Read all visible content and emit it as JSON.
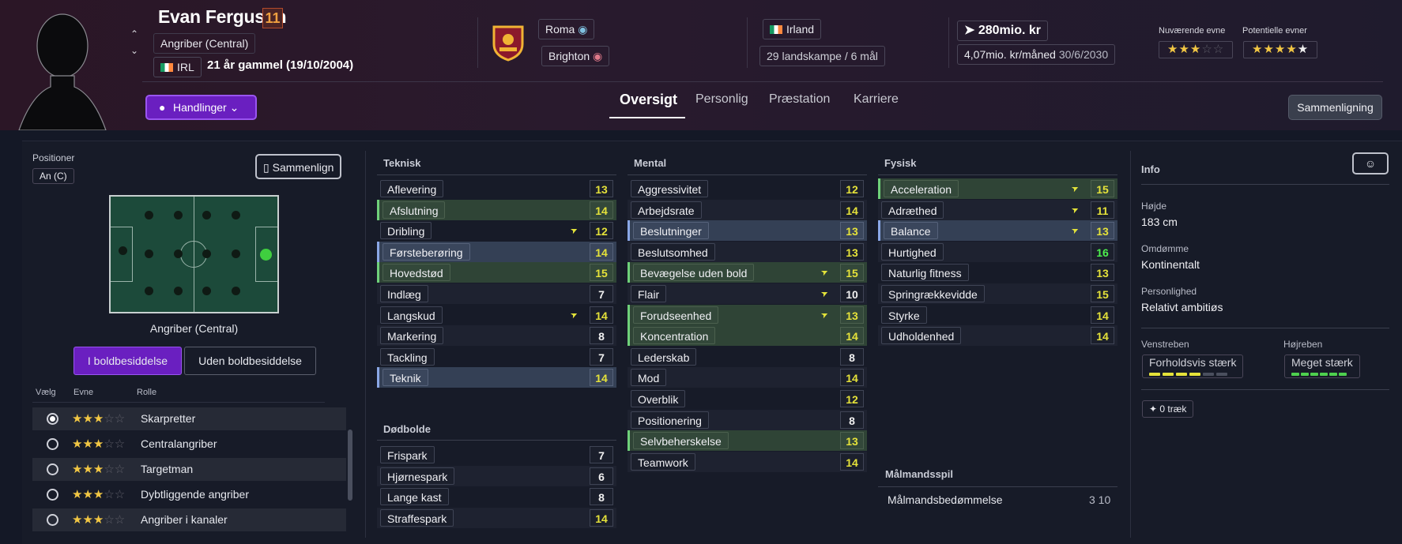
{
  "player": {
    "name": "Evan Ferguson",
    "number": "11",
    "position": "Angriber (Central)",
    "nation_code": "IRL",
    "age": "21 år gammel (19/10/2004)"
  },
  "clubs": {
    "current": "Roma",
    "loan": "Brighton"
  },
  "nation": {
    "name": "Irland",
    "caps": "29 landskampe / 6 mål"
  },
  "contract": {
    "value": "280mio. kr",
    "wage": "4,07mio. kr/måned",
    "expires": "30/6/2030"
  },
  "ability": {
    "current_label": "Nuværende evne",
    "potential_label": "Potentielle evner",
    "current_stars": 3,
    "potential_stars": 4.5
  },
  "nav": {
    "actions": "Handlinger",
    "tabs": [
      "Oversigt",
      "Personlig",
      "Præstation",
      "Karriere"
    ],
    "compare": "Sammenligning"
  },
  "positions_panel": {
    "title": "Positioner",
    "badge": "An (C)",
    "compare_btn": "Sammenlign",
    "pitch_label": "Angriber (Central)",
    "toggle_in": "I boldbesiddelse",
    "toggle_out": "Uden boldbesiddelse",
    "headers": {
      "select": "Vælg",
      "ability": "Evne",
      "role": "Rolle"
    },
    "roles": [
      {
        "name": "Skarpretter",
        "selected": true
      },
      {
        "name": "Centralangriber",
        "selected": false
      },
      {
        "name": "Targetman",
        "selected": false
      },
      {
        "name": "Dybtliggende angriber",
        "selected": false
      },
      {
        "name": "Angriber i kanaler",
        "selected": false
      }
    ]
  },
  "attributes": {
    "technical_title": "Teknisk",
    "technical": [
      {
        "name": "Aflevering",
        "value": "13"
      },
      {
        "name": "Afslutning",
        "value": "14"
      },
      {
        "name": "Dribling",
        "value": "12"
      },
      {
        "name": "Førsteberøring",
        "value": "14"
      },
      {
        "name": "Hovedstød",
        "value": "15"
      },
      {
        "name": "Indlæg",
        "value": "7"
      },
      {
        "name": "Langskud",
        "value": "14"
      },
      {
        "name": "Markering",
        "value": "8"
      },
      {
        "name": "Tackling",
        "value": "7"
      },
      {
        "name": "Teknik",
        "value": "14"
      }
    ],
    "setpieces_title": "Dødbolde",
    "setpieces": [
      {
        "name": "Frispark",
        "value": "7"
      },
      {
        "name": "Hjørnespark",
        "value": "6"
      },
      {
        "name": "Lange kast",
        "value": "8"
      },
      {
        "name": "Straffespark",
        "value": "14"
      }
    ],
    "mental_title": "Mental",
    "mental": [
      {
        "name": "Aggressivitet",
        "value": "12"
      },
      {
        "name": "Arbejdsrate",
        "value": "14"
      },
      {
        "name": "Beslutninger",
        "value": "13"
      },
      {
        "name": "Beslutsomhed",
        "value": "13"
      },
      {
        "name": "Bevægelse uden bold",
        "value": "15"
      },
      {
        "name": "Flair",
        "value": "10"
      },
      {
        "name": "Forudseenhed",
        "value": "13"
      },
      {
        "name": "Koncentration",
        "value": "14"
      },
      {
        "name": "Lederskab",
        "value": "8"
      },
      {
        "name": "Mod",
        "value": "14"
      },
      {
        "name": "Overblik",
        "value": "12"
      },
      {
        "name": "Positionering",
        "value": "8"
      },
      {
        "name": "Selvbeherskelse",
        "value": "13"
      },
      {
        "name": "Teamwork",
        "value": "14"
      }
    ],
    "physical_title": "Fysisk",
    "physical": [
      {
        "name": "Acceleration",
        "value": "15"
      },
      {
        "name": "Adræthed",
        "value": "11"
      },
      {
        "name": "Balance",
        "value": "13"
      },
      {
        "name": "Hurtighed",
        "value": "16"
      },
      {
        "name": "Naturlig fitness",
        "value": "13"
      },
      {
        "name": "Springrækkevidde",
        "value": "15"
      },
      {
        "name": "Styrke",
        "value": "14"
      },
      {
        "name": "Udholdenhed",
        "value": "14"
      }
    ],
    "gk_title": "Målmandsspil",
    "gk_label": "Målmandsbedømmelse",
    "gk_value": "3 10"
  },
  "info": {
    "title": "Info",
    "height_label": "Højde",
    "height": "183 cm",
    "reputation_label": "Omdømme",
    "reputation": "Kontinentalt",
    "personality_label": "Personlighed",
    "personality": "Relativt ambitiøs",
    "left_foot_label": "Venstreben",
    "left_foot": "Forholdsvis stærk",
    "right_foot_label": "Højreben",
    "right_foot": "Meget stærk",
    "traits": "0 træk"
  },
  "colors": {
    "accent": "#6a1fc0",
    "value_yellow": "#e5e23a",
    "value_green": "#4ef04e",
    "positive_row": "#2f4436",
    "key_row": "#344055"
  }
}
